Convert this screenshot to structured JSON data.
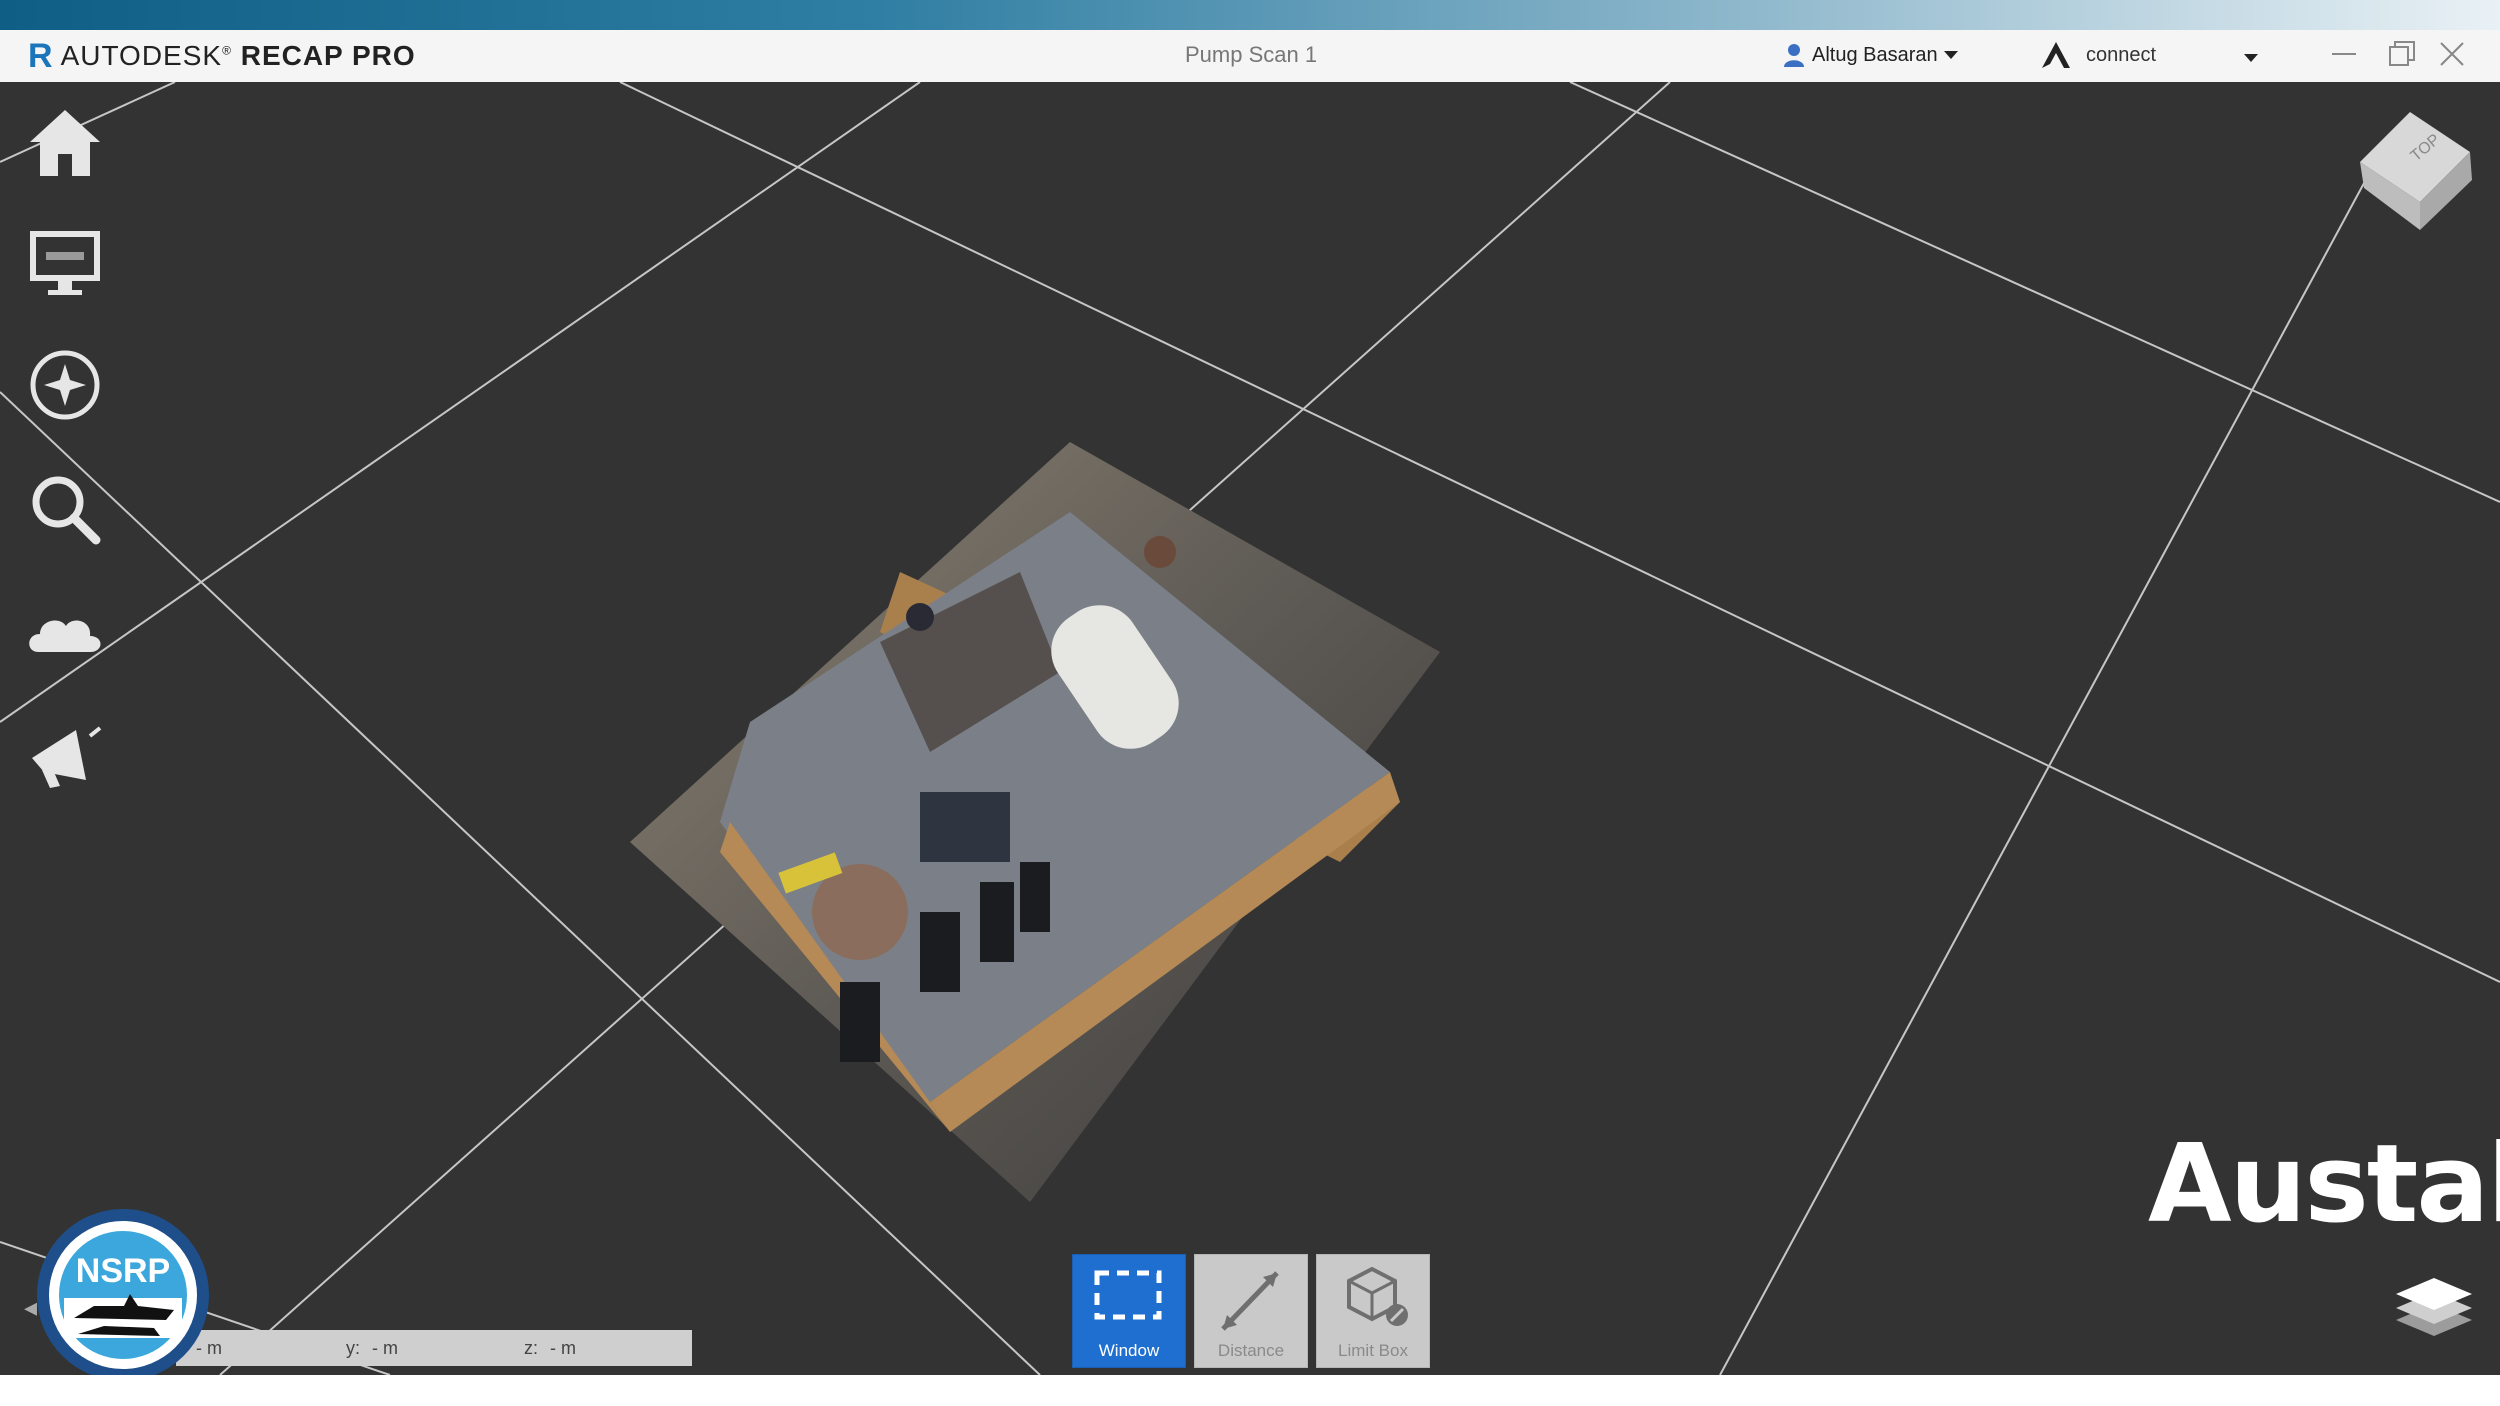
{
  "app": {
    "brand_letter": "R",
    "brand_prefix": "AUTODESK",
    "brand_product": "RECAP PRO",
    "document_title": "Pump Scan 1",
    "user_name": "Altug Basaran",
    "connect_label": "connect"
  },
  "sidebar": {
    "items": [
      {
        "name": "home",
        "icon": "home-icon"
      },
      {
        "name": "display",
        "icon": "monitor-icon"
      },
      {
        "name": "navigation",
        "icon": "compass-icon"
      },
      {
        "name": "search",
        "icon": "search-icon"
      },
      {
        "name": "cloud",
        "icon": "cloud-icon"
      },
      {
        "name": "announcements",
        "icon": "megaphone-icon"
      }
    ]
  },
  "viewcube": {
    "face_label": "TOP"
  },
  "tools": [
    {
      "label": "Window",
      "icon": "window-select-icon",
      "active": true
    },
    {
      "label": "Distance",
      "icon": "distance-icon",
      "active": false
    },
    {
      "label": "Limit Box",
      "icon": "limit-box-icon",
      "active": false
    }
  ],
  "coordinates": {
    "x_value": "- m",
    "y_label": "y:",
    "y_value": "- m",
    "z_label": "z:",
    "z_value": "- m"
  },
  "watermark": {
    "text": "Austal"
  },
  "logo": {
    "text": "NSRP"
  },
  "colors": {
    "viewport_bg": "#333333",
    "accent": "#1f6fd0",
    "grid": "#d9d9d9"
  }
}
